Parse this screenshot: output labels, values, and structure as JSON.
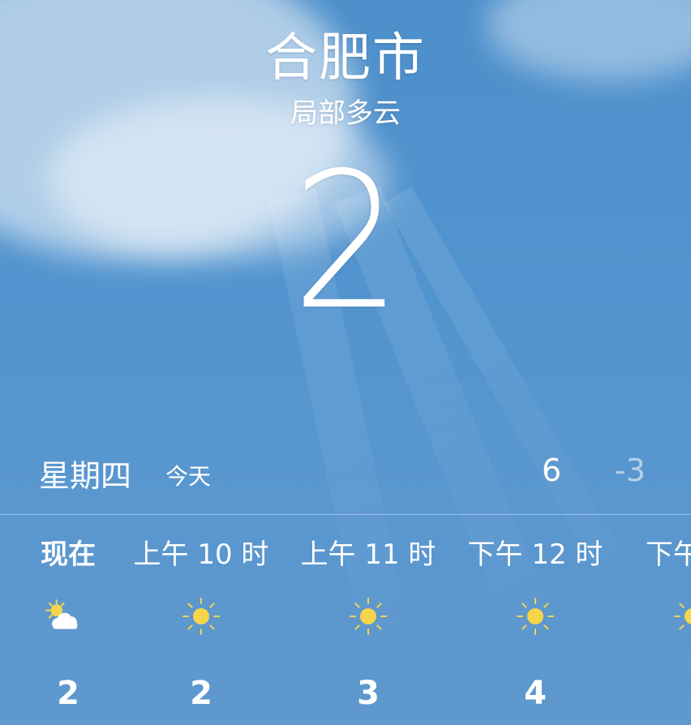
{
  "location": {
    "city": "合肥市",
    "condition": "局部多云",
    "current_temp": "2"
  },
  "day": {
    "name": "星期四",
    "today_label": "今天",
    "high": "6",
    "low": "-3"
  },
  "hourly": [
    {
      "label": "现在",
      "icon": "partly-cloudy-day-icon",
      "temp": "2"
    },
    {
      "label": "上午 10 时",
      "icon": "sun-icon",
      "temp": "2"
    },
    {
      "label": "上午 11 时",
      "icon": "sun-icon",
      "temp": "3"
    },
    {
      "label": "下午 12 时",
      "icon": "sun-icon",
      "temp": "4"
    },
    {
      "label": "下午",
      "icon": "sun-icon",
      "temp": ""
    }
  ],
  "colors": {
    "sky": "#5294cf",
    "sun": "#f7d54a",
    "text": "#ffffff"
  }
}
